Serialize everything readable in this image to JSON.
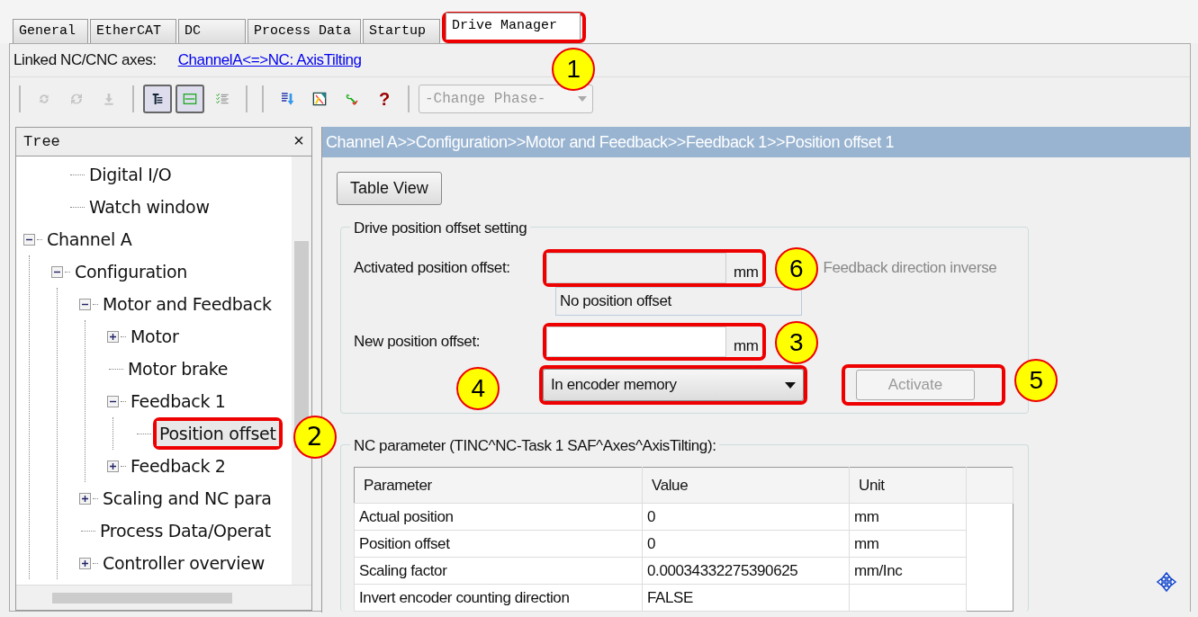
{
  "tabs": [
    {
      "label": "General",
      "selected": false,
      "highlighted": false
    },
    {
      "label": "EtherCAT",
      "selected": false,
      "highlighted": false
    },
    {
      "label": "DC",
      "selected": false,
      "highlighted": false
    },
    {
      "label": "Process Data",
      "selected": false,
      "highlighted": false
    },
    {
      "label": "Startup",
      "selected": false,
      "highlighted": false
    },
    {
      "label": "Drive Manager",
      "selected": true,
      "highlighted": true,
      "callout": "1"
    }
  ],
  "linked_axes": {
    "label": "Linked NC/CNC axes:",
    "link": "ChannelA<=>NC: AxisTilting"
  },
  "toolbar": {
    "buttons": [
      {
        "kind": "sync",
        "disabled": true,
        "pressed": false
      },
      {
        "kind": "sync2",
        "disabled": true,
        "pressed": false
      },
      {
        "kind": "download",
        "disabled": true,
        "pressed": false
      },
      {
        "kind": "tree",
        "disabled": false,
        "pressed": true
      },
      {
        "kind": "layout",
        "disabled": false,
        "pressed": true
      },
      {
        "kind": "checklist",
        "disabled": false,
        "pressed": false
      },
      {
        "kind": "sep"
      },
      {
        "kind": "import",
        "disabled": false,
        "pressed": false
      },
      {
        "kind": "chart",
        "disabled": false,
        "pressed": false
      },
      {
        "kind": "wrench",
        "disabled": false,
        "pressed": false
      },
      {
        "kind": "help",
        "text": "?",
        "disabled": false,
        "pressed": false
      },
      {
        "kind": "sep"
      }
    ],
    "phase": {
      "value": "-Change Phase-",
      "disabled": true
    }
  },
  "tree": {
    "title": "Tree",
    "close": "×",
    "items": [
      {
        "children": [
          {
            "label": "Digital I/O"
          },
          {
            "label": "Watch window"
          }
        ]
      },
      {
        "label": "Channel A",
        "expanded": true,
        "children": [
          {
            "label": "Configuration",
            "expanded": true,
            "children": [
              {
                "label": "Motor and Feedback",
                "expanded": true,
                "children": [
                  {
                    "label": "Motor",
                    "expanded": false
                  },
                  {
                    "label": "Motor brake"
                  },
                  {
                    "label": "Feedback 1",
                    "expanded": true,
                    "children": [
                      {
                        "label": "Position offset",
                        "selected": true,
                        "highlighted": true,
                        "callout": "2"
                      }
                    ]
                  },
                  {
                    "label": "Feedback 2",
                    "expanded": false
                  }
                ]
              },
              {
                "label": "Scaling and NC para",
                "expanded": false
              },
              {
                "label": "Process Data/Operat"
              },
              {
                "label": "Controller overview",
                "expanded": false
              }
            ]
          }
        ]
      }
    ]
  },
  "breadcrumb": "Channel A>>Configuration>>Motor and Feedback>>Feedback 1>>Position offset 1",
  "table_view_button": "Table View",
  "offset_group": {
    "title": "Drive position offset setting",
    "activated": {
      "label": "Activated position offset:",
      "unit": "mm",
      "disabled": true,
      "highlighted": true,
      "callout": "6"
    },
    "feedback_inverse": {
      "label": "Feedback direction inverse",
      "disabled": true
    },
    "offset_state": "No position offset",
    "new_offset": {
      "label": "New position offset:",
      "unit": "mm",
      "disabled": false,
      "highlighted": true,
      "callout": "3"
    },
    "target": {
      "value": "In encoder memory",
      "highlighted": true,
      "callout": "4"
    },
    "activate": {
      "label": "Activate",
      "disabled": true,
      "highlighted": true,
      "callout": "5"
    }
  },
  "nc_group": {
    "title": "NC parameter (TINC^NC-Task 1 SAF^Axes^AxisTilting):",
    "columns": [
      "Parameter",
      "Value",
      "Unit"
    ],
    "rows": [
      [
        "Actual position",
        "0",
        "mm"
      ],
      [
        "Position offset",
        "0",
        "mm"
      ],
      [
        "Scaling factor",
        "0.00034332275390625",
        "mm/Inc"
      ],
      [
        "Invert encoder counting direction",
        "FALSE",
        ""
      ]
    ]
  }
}
